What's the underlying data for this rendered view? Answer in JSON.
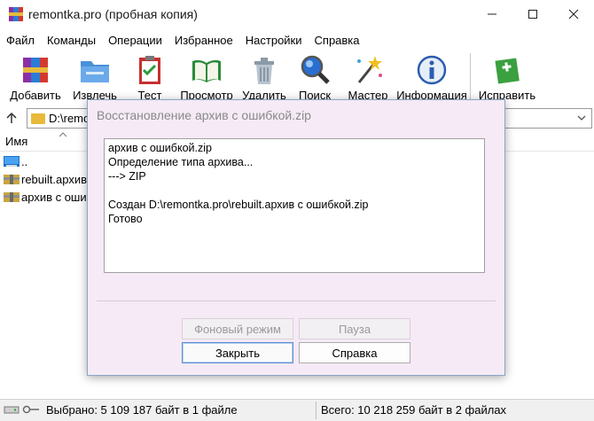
{
  "window": {
    "title": "remontka.pro (пробная копия)",
    "icons": {
      "minimize": "minimize-icon",
      "maximize": "maximize-icon",
      "close": "close-icon"
    }
  },
  "menu": [
    "Файл",
    "Команды",
    "Операции",
    "Избранное",
    "Настройки",
    "Справка"
  ],
  "toolbar": {
    "buttons": [
      {
        "label": "Добавить",
        "icon": "add-archive-icon"
      },
      {
        "label": "Извлечь",
        "icon": "extract-folder-icon"
      },
      {
        "label": "Тест",
        "icon": "test-clipboard-icon"
      },
      {
        "label": "Просмотр",
        "icon": "view-book-icon"
      },
      {
        "label": "Удалить",
        "icon": "trash-icon"
      },
      {
        "label": "Поиск",
        "icon": "magnifier-icon"
      },
      {
        "label": "Мастер",
        "icon": "wizard-wand-icon"
      },
      {
        "label": "Информация",
        "icon": "info-icon"
      },
      {
        "label": "Исправить",
        "icon": "repair-kit-icon"
      }
    ]
  },
  "address": {
    "path": "D:\\remo"
  },
  "filelist": {
    "column_name": "Имя",
    "rows": [
      {
        "name": "..",
        "icon": "parent-folder-icon"
      },
      {
        "name": "rebuilt.архив",
        "icon": "archive-file-icon"
      },
      {
        "name": "архив с оши",
        "icon": "archive-file-icon"
      }
    ]
  },
  "status": {
    "selected": "Выбрано: 5 109 187 байт в 1 файле",
    "total": "Всего: 10 218 259 байт в 2 файлах"
  },
  "dialog": {
    "title": "Восстановление архив с ошибкой.zip",
    "log": [
      "архив с ошибкой.zip",
      "Определение типа архива...",
      "---> ZIP",
      "",
      "Создан D:\\remontka.pro\\rebuilt.архив с ошибкой.zip",
      "Готово"
    ],
    "buttons": {
      "background": "Фоновый режим",
      "pause": "Пауза",
      "close": "Закрыть",
      "help": "Справка"
    }
  }
}
